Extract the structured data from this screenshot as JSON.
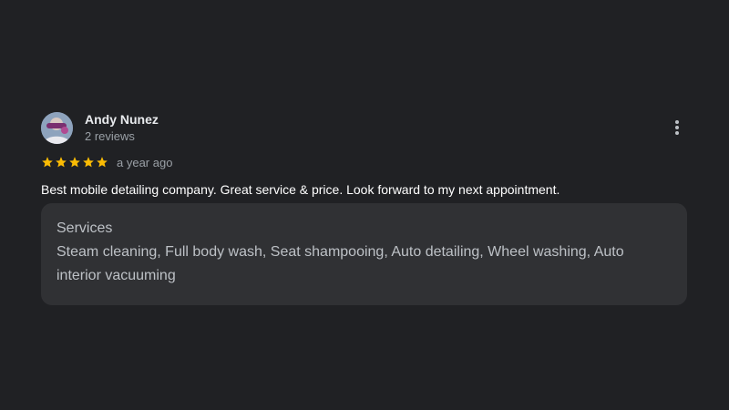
{
  "review": {
    "author_name": "Andy Nunez",
    "author_meta": "2 reviews",
    "rating": 5,
    "rating_max": 5,
    "star_color": "#fbbc04",
    "time": "a year ago",
    "text": "Best mobile detailing company. Great service & price. Look forward to my next appointment.",
    "services": {
      "title": "Services",
      "list": "Steam cleaning, Full body wash, Seat shampooing, Auto detailing, Wheel washing, Auto interior vacuuming"
    },
    "icons": {
      "more": "more-vertical-icon",
      "star": "star-icon"
    }
  }
}
